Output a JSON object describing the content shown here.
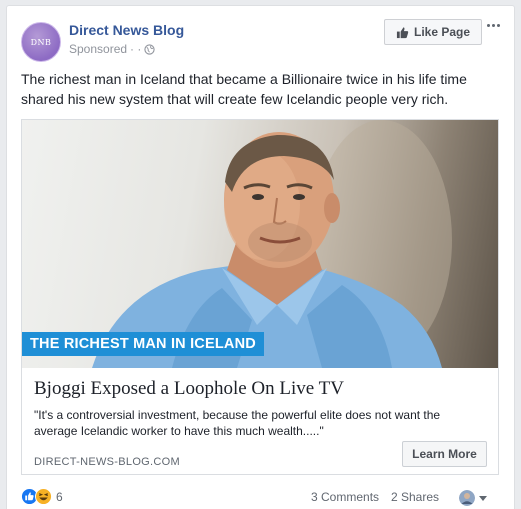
{
  "post": {
    "page_name": "Direct News Blog",
    "avatar_logo_text": "DNB",
    "sponsored_label": "Sponsored",
    "meta_separator": "· ·",
    "like_page_label": "Like Page",
    "text": "The richest man in Iceland that became a Billionaire twice in his life time shared his new system that will create few Icelandic people very rich."
  },
  "link_preview": {
    "image_caption": "THE RICHEST MAN IN ICELAND",
    "headline": "Bjoggi Exposed a Loophole On Live TV",
    "description": "\"It's a controversial investment, because the powerful elite does not want the average Icelandic worker to have this much wealth.....\"",
    "domain": "DIRECT-NEWS-BLOG.COM",
    "cta_label": "Learn More"
  },
  "engagement": {
    "reaction_count": "6",
    "reaction_icons": [
      "like-reaction-icon",
      "haha-reaction-icon"
    ],
    "comments": "3 Comments",
    "shares": "2 Shares"
  },
  "colors": {
    "link_blue": "#365899",
    "caption_blue": "#1f8fd6",
    "background": "#e9ebee"
  }
}
